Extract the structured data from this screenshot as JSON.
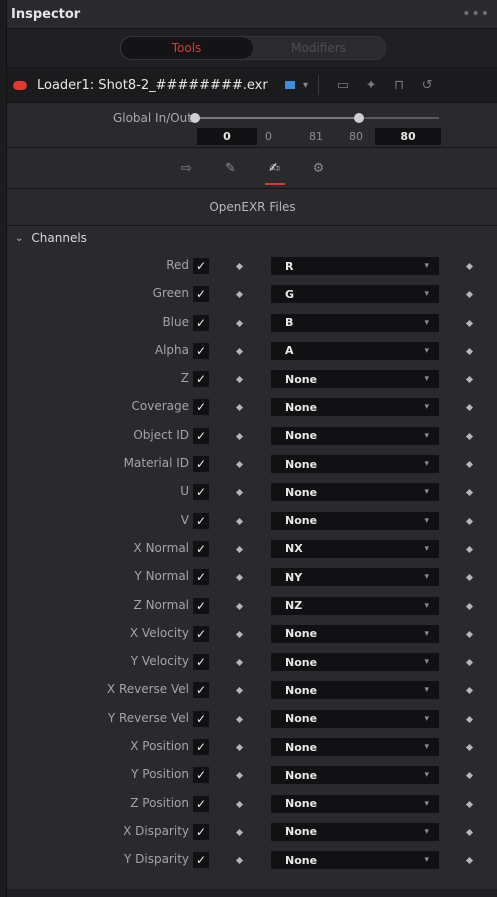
{
  "window": {
    "title": "Inspector"
  },
  "tabs": {
    "tools": "Tools",
    "modifiers": "Modifiers"
  },
  "loader": {
    "name": "Loader1: Shot8-2_########.exr"
  },
  "global_inout": {
    "label": "Global In/Out",
    "in_value": "0",
    "range_start": "0",
    "range_mid": "81",
    "range_end": "80",
    "out_value": "80"
  },
  "file_type": "OpenEXR Files",
  "channels_section": {
    "label": "Channels"
  },
  "channels": [
    {
      "name": "Red",
      "value": "R"
    },
    {
      "name": "Green",
      "value": "G"
    },
    {
      "name": "Blue",
      "value": "B"
    },
    {
      "name": "Alpha",
      "value": "A"
    },
    {
      "name": "Z",
      "value": "None"
    },
    {
      "name": "Coverage",
      "value": "None"
    },
    {
      "name": "Object ID",
      "value": "None"
    },
    {
      "name": "Material ID",
      "value": "None"
    },
    {
      "name": "U",
      "value": "None"
    },
    {
      "name": "V",
      "value": "None"
    },
    {
      "name": "X Normal",
      "value": "NX"
    },
    {
      "name": "Y Normal",
      "value": "NY"
    },
    {
      "name": "Z Normal",
      "value": "NZ"
    },
    {
      "name": "X Velocity",
      "value": "None"
    },
    {
      "name": "Y Velocity",
      "value": "None"
    },
    {
      "name": "X Reverse Vel",
      "value": "None"
    },
    {
      "name": "Y Reverse Vel",
      "value": "None"
    },
    {
      "name": "X Position",
      "value": "None"
    },
    {
      "name": "Y Position",
      "value": "None"
    },
    {
      "name": "Z Position",
      "value": "None"
    },
    {
      "name": "X Disparity",
      "value": "None"
    },
    {
      "name": "Y Disparity",
      "value": "None"
    }
  ],
  "colors": {
    "accent": "#d43b33",
    "swatch": "#3b8de0"
  }
}
